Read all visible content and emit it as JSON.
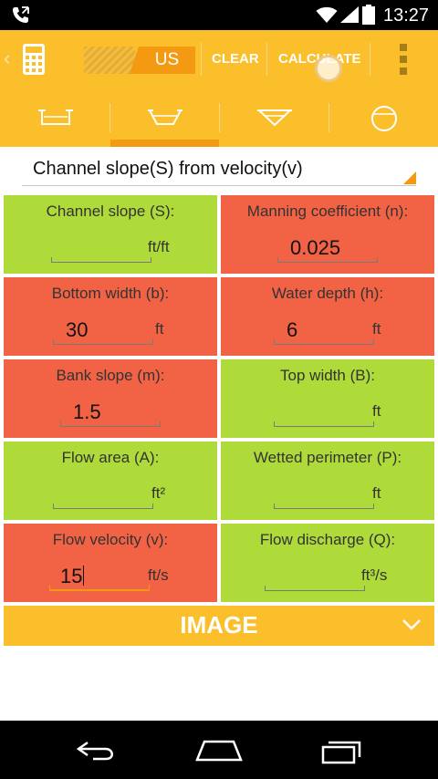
{
  "status_bar": {
    "time": "13:27"
  },
  "action_bar": {
    "unit_selected": "US",
    "clear_label": "CLEAR",
    "calculate_label": "CALCULATE"
  },
  "tabs": [
    {
      "icon": "rectangular-channel-icon",
      "selected": false
    },
    {
      "icon": "trapezoidal-channel-icon",
      "selected": true
    },
    {
      "icon": "triangular-channel-icon",
      "selected": false
    },
    {
      "icon": "circular-channel-icon",
      "selected": false
    }
  ],
  "mode_dropdown": {
    "selected": "Channel slope(S) from velocity(v)"
  },
  "fields": {
    "channel_slope": {
      "label": "Channel slope (S):",
      "value": "",
      "unit": "ft/ft"
    },
    "manning": {
      "label": "Manning coefficient (n):",
      "value": "0.025",
      "unit": ""
    },
    "bottom_width": {
      "label": "Bottom width (b):",
      "value": "30",
      "unit": "ft"
    },
    "water_depth": {
      "label": "Water depth (h):",
      "value": "6",
      "unit": "ft"
    },
    "bank_slope": {
      "label": "Bank slope (m):",
      "value": "1.5",
      "unit": ""
    },
    "top_width": {
      "label": "Top width (B):",
      "value": "",
      "unit": "ft"
    },
    "flow_area": {
      "label": "Flow area (A):",
      "value": "",
      "unit": "ft²"
    },
    "wetted_perimeter": {
      "label": "Wetted perimeter (P):",
      "value": "",
      "unit": "ft"
    },
    "flow_velocity": {
      "label": "Flow velocity (v):",
      "value": "15",
      "unit": "ft/s"
    },
    "flow_discharge": {
      "label": "Flow discharge (Q):",
      "value": "",
      "unit": "ft³/s"
    }
  },
  "image_section": {
    "label": "IMAGE"
  },
  "colors": {
    "accent": "#fbbf2c",
    "input_cell": "#f26346",
    "output_cell": "#aedb3a",
    "highlight": "#f39a12"
  }
}
